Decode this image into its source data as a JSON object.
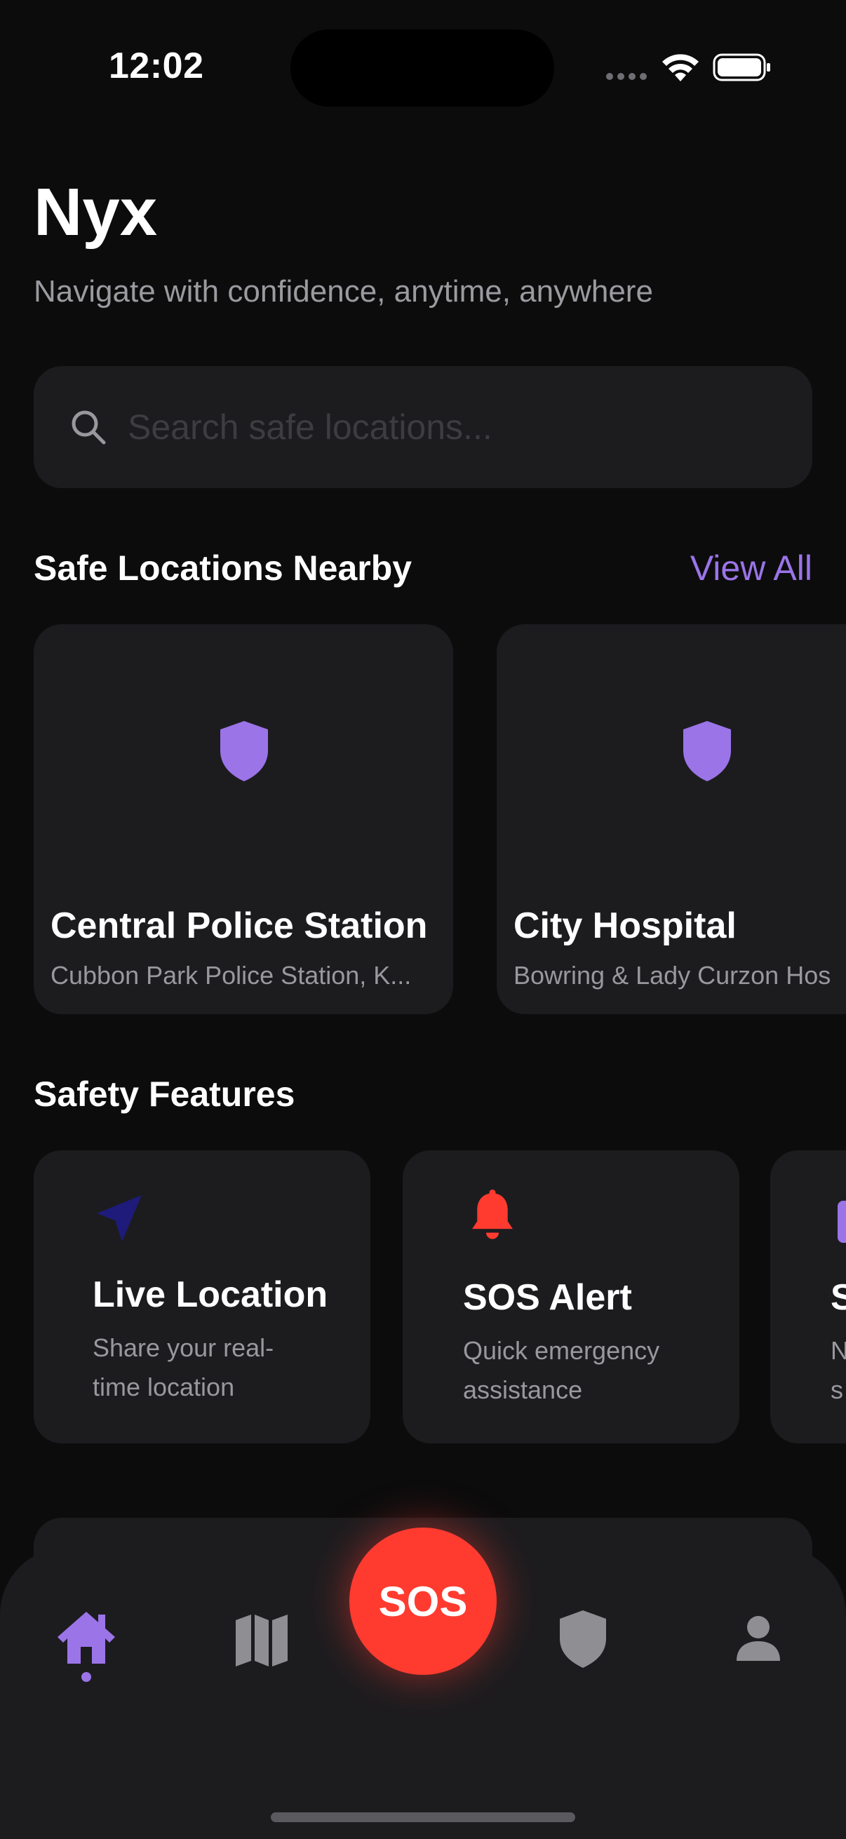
{
  "status_bar": {
    "time": "12:02"
  },
  "header": {
    "title": "Nyx",
    "subtitle": "Navigate with confidence, anytime, anywhere"
  },
  "search": {
    "placeholder": "Search safe locations...",
    "value": ""
  },
  "safe_locations": {
    "title": "Safe Locations Nearby",
    "view_all_label": "View All",
    "icon": "shield-icon",
    "items": [
      {
        "name": "Central Police Station",
        "address": "Cubbon Park Police Station, K..."
      },
      {
        "name": "City Hospital",
        "address": "Bowring & Lady Curzon Hos"
      }
    ]
  },
  "safety_features": {
    "title": "Safety Features",
    "items": [
      {
        "title": "Live Location",
        "description": "Share your real-time location",
        "icon": "navigation-arrow-icon"
      },
      {
        "title": "SOS Alert",
        "description": "Quick emergency assistance",
        "icon": "bell-icon"
      },
      {
        "title": "S",
        "description": "N s",
        "icon": "feature-icon"
      }
    ]
  },
  "tab_bar": {
    "active_tab": "home",
    "tabs": [
      {
        "id": "home",
        "icon": "home-icon"
      },
      {
        "id": "map",
        "icon": "map-icon"
      },
      {
        "id": "sos",
        "label": "SOS"
      },
      {
        "id": "safety",
        "icon": "shield-icon"
      },
      {
        "id": "profile",
        "icon": "person-icon"
      }
    ]
  },
  "colors": {
    "background": "#0c0c0d",
    "card": "#1c1c1f",
    "accent": "#9b74e8",
    "sos": "#ff3b30",
    "navy_icon": "#1e1b7a",
    "muted_text": "#98989d"
  }
}
